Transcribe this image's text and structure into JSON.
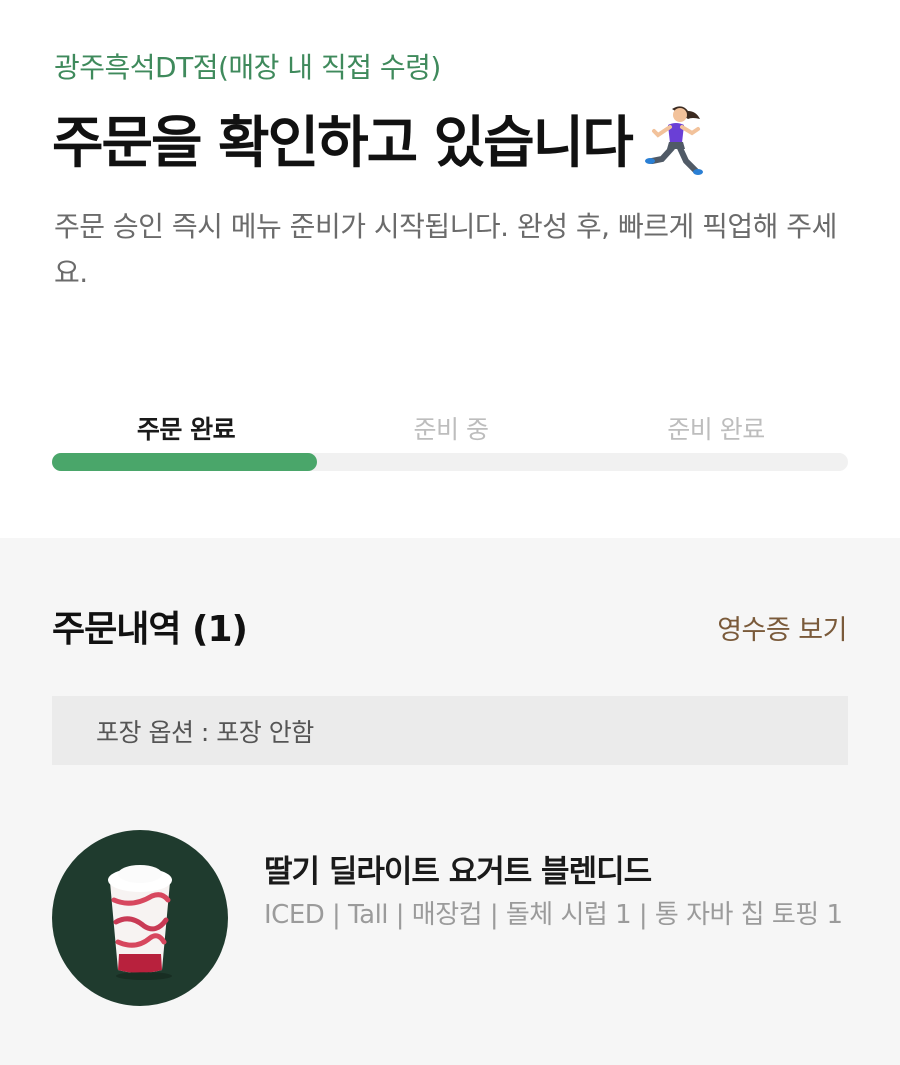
{
  "header": {
    "store_name": "광주흑석DT점(매장 내 직접 수령)",
    "headline": "주문을 확인하고 있습니다",
    "runner_icon": "running-woman-emoji",
    "subtext": "주문 승인 즉시 메뉴 준비가 시작됩니다. 완성 후, 빠르게 픽업해 주세요."
  },
  "progress": {
    "steps": [
      {
        "label": "주문 완료",
        "active": true
      },
      {
        "label": "준비 중",
        "active": false
      },
      {
        "label": "준비 완료",
        "active": false
      }
    ],
    "fill_fraction": 0.333,
    "fill_color": "#4aa66a"
  },
  "order": {
    "title": "주문내역 (1)",
    "receipt_link": "영수증 보기",
    "packaging": "포장 옵션 : 포장 안함",
    "items": [
      {
        "name": "딸기 딜라이트 요거트 블렌디드",
        "options": "ICED | Tall | 매장컵 | 돌체 시럽 1 | 통 자바 칩 토핑 1",
        "thumb_bg": "#1f3b2e"
      }
    ]
  },
  "colors": {
    "accent_green": "#3f8a5c",
    "receipt_brown": "#7a5a3a"
  }
}
